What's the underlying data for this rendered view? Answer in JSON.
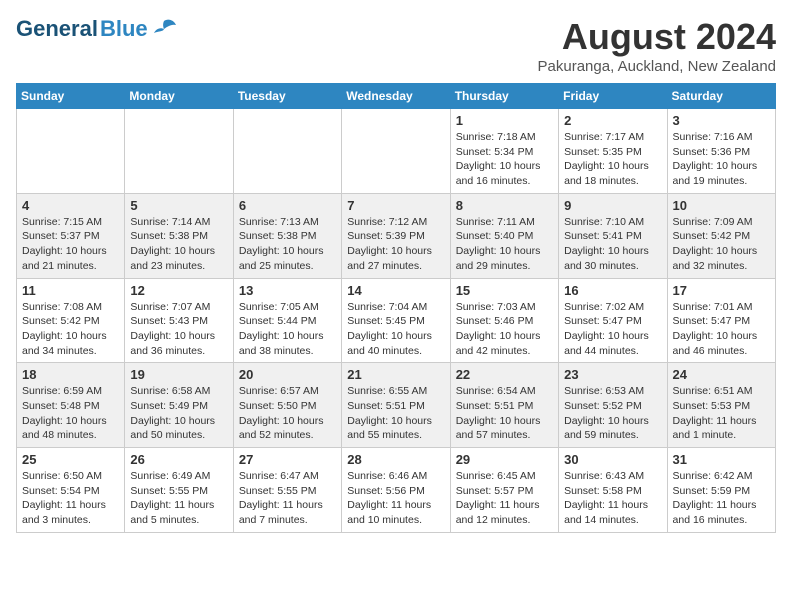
{
  "header": {
    "logo_general": "General",
    "logo_blue": "Blue",
    "month_title": "August 2024",
    "location": "Pakuranga, Auckland, New Zealand"
  },
  "weekdays": [
    "Sunday",
    "Monday",
    "Tuesday",
    "Wednesday",
    "Thursday",
    "Friday",
    "Saturday"
  ],
  "weeks": [
    [
      {
        "day": "",
        "info": ""
      },
      {
        "day": "",
        "info": ""
      },
      {
        "day": "",
        "info": ""
      },
      {
        "day": "",
        "info": ""
      },
      {
        "day": "1",
        "info": "Sunrise: 7:18 AM\nSunset: 5:34 PM\nDaylight: 10 hours\nand 16 minutes."
      },
      {
        "day": "2",
        "info": "Sunrise: 7:17 AM\nSunset: 5:35 PM\nDaylight: 10 hours\nand 18 minutes."
      },
      {
        "day": "3",
        "info": "Sunrise: 7:16 AM\nSunset: 5:36 PM\nDaylight: 10 hours\nand 19 minutes."
      }
    ],
    [
      {
        "day": "4",
        "info": "Sunrise: 7:15 AM\nSunset: 5:37 PM\nDaylight: 10 hours\nand 21 minutes."
      },
      {
        "day": "5",
        "info": "Sunrise: 7:14 AM\nSunset: 5:38 PM\nDaylight: 10 hours\nand 23 minutes."
      },
      {
        "day": "6",
        "info": "Sunrise: 7:13 AM\nSunset: 5:38 PM\nDaylight: 10 hours\nand 25 minutes."
      },
      {
        "day": "7",
        "info": "Sunrise: 7:12 AM\nSunset: 5:39 PM\nDaylight: 10 hours\nand 27 minutes."
      },
      {
        "day": "8",
        "info": "Sunrise: 7:11 AM\nSunset: 5:40 PM\nDaylight: 10 hours\nand 29 minutes."
      },
      {
        "day": "9",
        "info": "Sunrise: 7:10 AM\nSunset: 5:41 PM\nDaylight: 10 hours\nand 30 minutes."
      },
      {
        "day": "10",
        "info": "Sunrise: 7:09 AM\nSunset: 5:42 PM\nDaylight: 10 hours\nand 32 minutes."
      }
    ],
    [
      {
        "day": "11",
        "info": "Sunrise: 7:08 AM\nSunset: 5:42 PM\nDaylight: 10 hours\nand 34 minutes."
      },
      {
        "day": "12",
        "info": "Sunrise: 7:07 AM\nSunset: 5:43 PM\nDaylight: 10 hours\nand 36 minutes."
      },
      {
        "day": "13",
        "info": "Sunrise: 7:05 AM\nSunset: 5:44 PM\nDaylight: 10 hours\nand 38 minutes."
      },
      {
        "day": "14",
        "info": "Sunrise: 7:04 AM\nSunset: 5:45 PM\nDaylight: 10 hours\nand 40 minutes."
      },
      {
        "day": "15",
        "info": "Sunrise: 7:03 AM\nSunset: 5:46 PM\nDaylight: 10 hours\nand 42 minutes."
      },
      {
        "day": "16",
        "info": "Sunrise: 7:02 AM\nSunset: 5:47 PM\nDaylight: 10 hours\nand 44 minutes."
      },
      {
        "day": "17",
        "info": "Sunrise: 7:01 AM\nSunset: 5:47 PM\nDaylight: 10 hours\nand 46 minutes."
      }
    ],
    [
      {
        "day": "18",
        "info": "Sunrise: 6:59 AM\nSunset: 5:48 PM\nDaylight: 10 hours\nand 48 minutes."
      },
      {
        "day": "19",
        "info": "Sunrise: 6:58 AM\nSunset: 5:49 PM\nDaylight: 10 hours\nand 50 minutes."
      },
      {
        "day": "20",
        "info": "Sunrise: 6:57 AM\nSunset: 5:50 PM\nDaylight: 10 hours\nand 52 minutes."
      },
      {
        "day": "21",
        "info": "Sunrise: 6:55 AM\nSunset: 5:51 PM\nDaylight: 10 hours\nand 55 minutes."
      },
      {
        "day": "22",
        "info": "Sunrise: 6:54 AM\nSunset: 5:51 PM\nDaylight: 10 hours\nand 57 minutes."
      },
      {
        "day": "23",
        "info": "Sunrise: 6:53 AM\nSunset: 5:52 PM\nDaylight: 10 hours\nand 59 minutes."
      },
      {
        "day": "24",
        "info": "Sunrise: 6:51 AM\nSunset: 5:53 PM\nDaylight: 11 hours\nand 1 minute."
      }
    ],
    [
      {
        "day": "25",
        "info": "Sunrise: 6:50 AM\nSunset: 5:54 PM\nDaylight: 11 hours\nand 3 minutes."
      },
      {
        "day": "26",
        "info": "Sunrise: 6:49 AM\nSunset: 5:55 PM\nDaylight: 11 hours\nand 5 minutes."
      },
      {
        "day": "27",
        "info": "Sunrise: 6:47 AM\nSunset: 5:55 PM\nDaylight: 11 hours\nand 7 minutes."
      },
      {
        "day": "28",
        "info": "Sunrise: 6:46 AM\nSunset: 5:56 PM\nDaylight: 11 hours\nand 10 minutes."
      },
      {
        "day": "29",
        "info": "Sunrise: 6:45 AM\nSunset: 5:57 PM\nDaylight: 11 hours\nand 12 minutes."
      },
      {
        "day": "30",
        "info": "Sunrise: 6:43 AM\nSunset: 5:58 PM\nDaylight: 11 hours\nand 14 minutes."
      },
      {
        "day": "31",
        "info": "Sunrise: 6:42 AM\nSunset: 5:59 PM\nDaylight: 11 hours\nand 16 minutes."
      }
    ]
  ]
}
